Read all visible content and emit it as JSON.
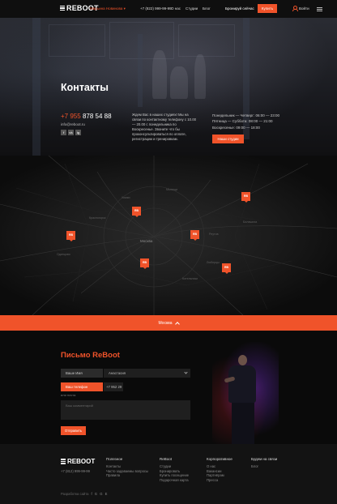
{
  "header": {
    "logo": "REBOOT",
    "location": "Марьина Новинова",
    "phone": "+7 (822) 999-99-99",
    "nav": [
      "О нас",
      "Студии",
      "Блог"
    ],
    "book_now": "Бронируй сейчас",
    "buy_button": "Купить",
    "login": "Войти"
  },
  "hero": {
    "title": "Контакты",
    "phone_prefix": "+7 955",
    "phone_rest": "878 54 88",
    "email": "info@reboot.ru",
    "socials": [
      "f",
      "vk",
      "ig"
    ],
    "intro": "Ждем Вас в наших студиях! Мы на связи по контактному телефону с 10.00 — 20.00 с понедельника по Воскресенье. Звоните что бы проконсультироваться по оплате, регистрации и тренировкам.",
    "hours": [
      "Понедельник — Четверг: 06:00 — 23:00",
      "Пятница — Суббота: 08:00 — 21:00",
      "Воскресенье: 09:00 — 18:00"
    ],
    "studio_button": "Наши студии"
  },
  "map": {
    "labels": [
      "Москва",
      "Мытищи",
      "Химки",
      "Реутов",
      "Балашиха",
      "Люберцы",
      "Котельники",
      "Одинцово",
      "Красногорск"
    ],
    "city": "Москва"
  },
  "form": {
    "title": "Письмо ReBoot",
    "name_label": "Ваше Имя",
    "name_value": "Анастасия",
    "phone_label": "Ваш телефон",
    "phone_value": "+7 952 29",
    "or_mail": "или почта",
    "comment_placeholder": "Ваш комментарий",
    "send_button": "Отправить"
  },
  "footer": {
    "logo": "REBOOT",
    "phone": "+7 (812) 999-99-99",
    "columns": [
      {
        "heading": "Полезное",
        "items": [
          "Контакты",
          "Часто задаваемы вопросы",
          "Правила"
        ]
      },
      {
        "heading": "ReBoot",
        "items": [
          "Студии",
          "Бронировать",
          "Купить посещение",
          "Подарочная карта"
        ]
      },
      {
        "heading": "Корпоративное",
        "items": [
          "О нас",
          "Вакансии",
          "Партнёрам",
          "Пресса"
        ]
      },
      {
        "heading": "Будем на связи",
        "items": [
          "Блог"
        ]
      }
    ],
    "developer": "Разработка сайта",
    "developer_mark": "f G G E"
  }
}
